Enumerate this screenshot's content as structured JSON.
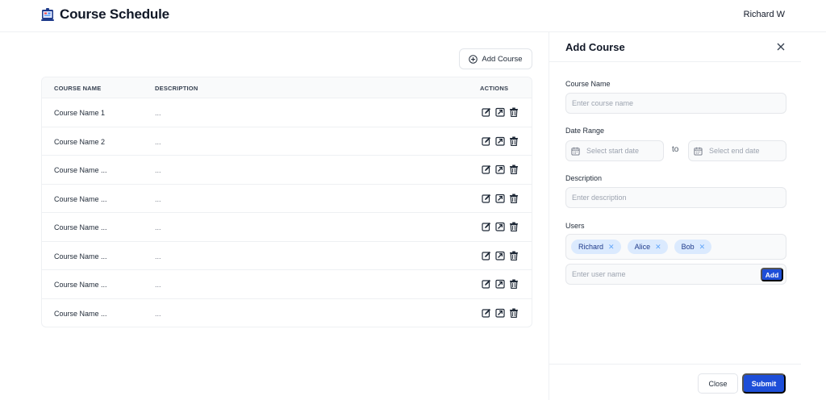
{
  "header": {
    "title": "Course Schedule",
    "user": "Richard W",
    "logo_icon": "calendar-board-icon"
  },
  "toolbar": {
    "add_course_label": "Add Course",
    "add_course_icon": "plus-circle-icon"
  },
  "table": {
    "columns": [
      "COURSE NAME",
      "DESCRIPTION",
      "ACTIONS"
    ],
    "rows": [
      {
        "name": "Course Name 1",
        "description": "..."
      },
      {
        "name": "Course Name 2",
        "description": "..."
      },
      {
        "name": "Course Name ...",
        "description": "..."
      },
      {
        "name": "Course Name ...",
        "description": "..."
      },
      {
        "name": "Course Name ...",
        "description": "..."
      },
      {
        "name": "Course Name ...",
        "description": "..."
      },
      {
        "name": "Course Name ...",
        "description": "..."
      },
      {
        "name": "Course Name ...",
        "description": "..."
      }
    ],
    "action_icons": [
      "edit-icon",
      "open-icon",
      "trash-icon"
    ]
  },
  "panel": {
    "title": "Add Course",
    "course_name": {
      "label": "Course Name",
      "placeholder": "Enter course name"
    },
    "date_range": {
      "label": "Date Range",
      "start_placeholder": "Select start date",
      "separator": "to",
      "end_placeholder": "Select end date"
    },
    "description": {
      "label": "Description",
      "placeholder": "Enter description"
    },
    "users": {
      "label": "Users",
      "chips": [
        "Richard",
        "Alice",
        "Bob"
      ],
      "input_placeholder": "Enter user name",
      "add_label": "Add"
    },
    "close_label": "Close",
    "submit_label": "Submit"
  },
  "colors": {
    "accent": "#1d4ed8",
    "chip_bg": "#dbeafe",
    "border": "#eef0f3"
  }
}
